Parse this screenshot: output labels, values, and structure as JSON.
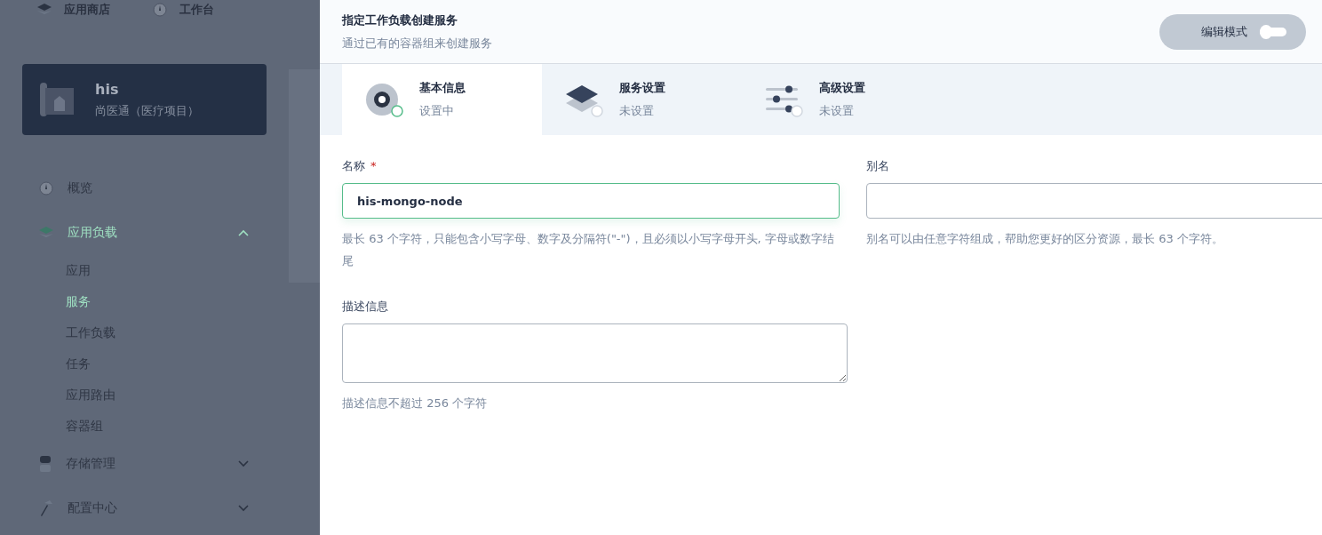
{
  "top_nav": [
    {
      "label": "应用商店"
    },
    {
      "label": "工作台"
    }
  ],
  "project": {
    "name": "his",
    "description": "尚医通（医疗项目）"
  },
  "sidebar": {
    "items": [
      {
        "label": "概览",
        "selected": false
      },
      {
        "label": "应用负载",
        "selected": true,
        "expanded": true,
        "children": [
          {
            "label": "应用",
            "selected": false
          },
          {
            "label": "服务",
            "selected": true
          },
          {
            "label": "工作负载",
            "selected": false
          },
          {
            "label": "任务",
            "selected": false
          },
          {
            "label": "应用路由",
            "selected": false
          },
          {
            "label": "容器组",
            "selected": false
          }
        ]
      },
      {
        "label": "存储管理",
        "selected": false,
        "expanded": false
      },
      {
        "label": "配置中心",
        "selected": false,
        "expanded": false
      }
    ]
  },
  "dialog": {
    "title": "指定工作负载创建服务",
    "subtitle": "通过已有的容器组来创建服务",
    "edit_mode": {
      "label": "编辑模式",
      "on": false
    },
    "steps": [
      {
        "kind": "info",
        "title": "基本信息",
        "status": "设置中",
        "selected": true
      },
      {
        "kind": "service",
        "title": "服务设置",
        "status": "未设置",
        "selected": false
      },
      {
        "kind": "advanced",
        "title": "高级设置",
        "status": "未设置",
        "selected": false
      }
    ],
    "form": {
      "name": {
        "label": "名称",
        "required_mark": "*",
        "value": "his-mongo-node",
        "hint": "最长 63 个字符，只能包含小写字母、数字及分隔符(\"-\")，且必须以小写字母开头, 字母或数字结尾"
      },
      "alias": {
        "label": "别名",
        "hint": "别名可以由任意字符组成，帮助您更好的区分资源，最长 63 个字符。"
      },
      "description": {
        "label": "描述信息",
        "hint": "描述信息不超过 256 个字符"
      }
    }
  }
}
